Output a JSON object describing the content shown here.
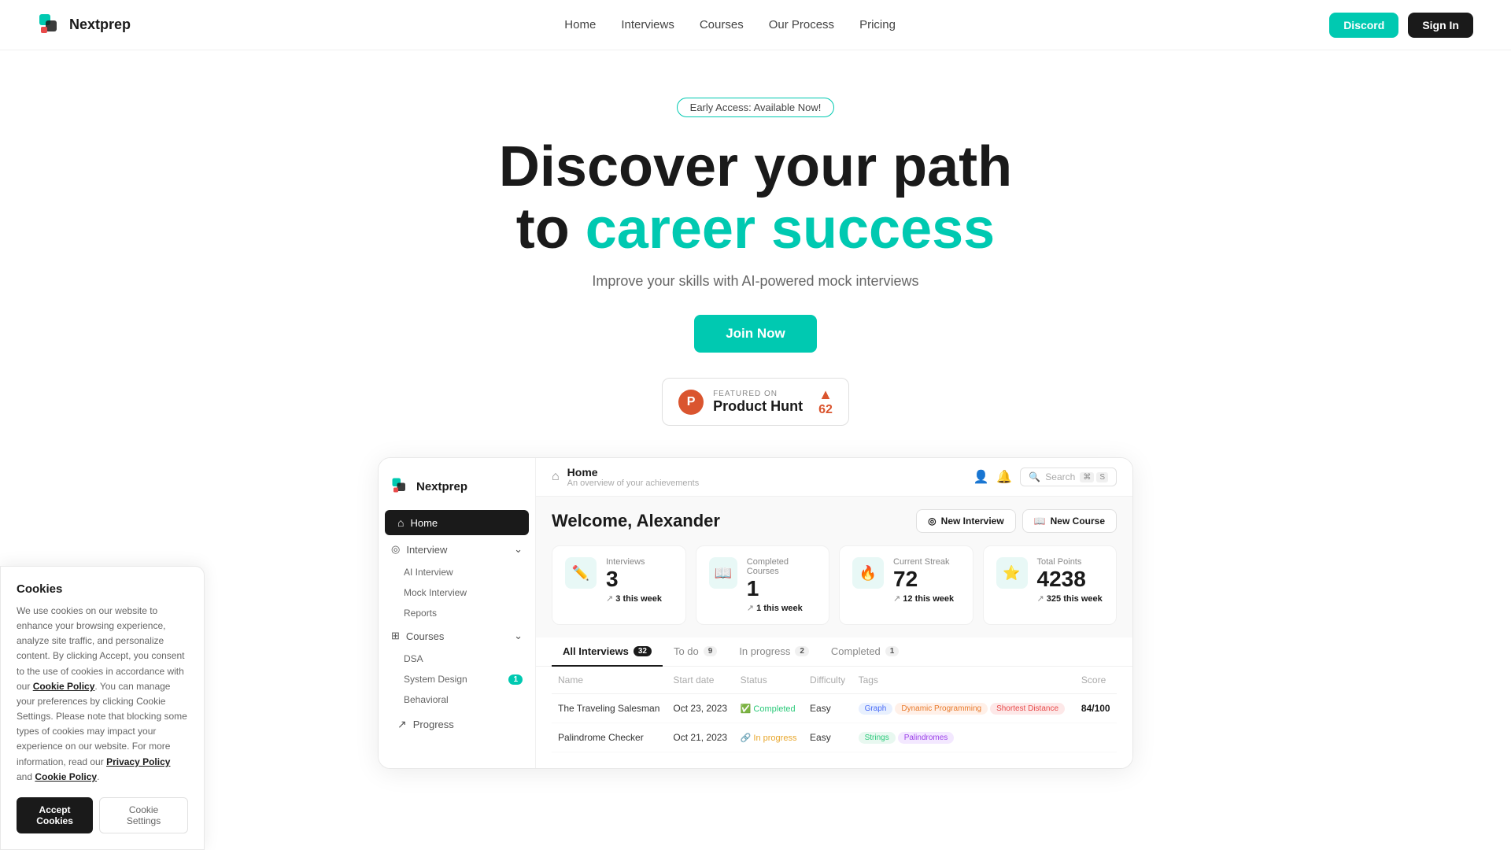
{
  "nav": {
    "logo_text": "Nextprep",
    "links": [
      "Home",
      "Interviews",
      "Courses",
      "Our Process",
      "Pricing"
    ],
    "discord_label": "Discord",
    "signin_label": "Sign In"
  },
  "hero": {
    "badge": "Early Access: Available Now!",
    "title_line1": "Discover your path",
    "title_line2_start": "to ",
    "title_line2_accent": "career success",
    "subtitle": "Improve your skills with AI-powered mock interviews",
    "cta_label": "Join Now",
    "product_hunt": {
      "featured_on": "FEATURED ON",
      "name": "Product Hunt",
      "votes": "62"
    }
  },
  "sidebar": {
    "logo_text": "Nextprep",
    "items": [
      {
        "label": "Home",
        "active": true
      },
      {
        "label": "Interview",
        "expandable": true
      },
      {
        "label": "AI Interview",
        "sub": true
      },
      {
        "label": "Mock Interview",
        "sub": true
      },
      {
        "label": "Reports",
        "sub": true
      },
      {
        "label": "Courses",
        "expandable": true
      },
      {
        "label": "DSA",
        "sub": true
      },
      {
        "label": "System Design",
        "sub": true,
        "badge": "1"
      },
      {
        "label": "Behavioral",
        "sub": true
      },
      {
        "label": "Progress"
      }
    ]
  },
  "topbar": {
    "home_label": "Home",
    "home_subtitle": "An overview of your achievements",
    "search_placeholder": "Search",
    "search_shortcut_1": "⌘",
    "search_shortcut_2": "S"
  },
  "welcome": {
    "greeting": "Welcome, Alexander",
    "btn_new_interview": "New Interview",
    "btn_new_course": "New Course"
  },
  "stats": [
    {
      "label": "Interviews",
      "value": "3",
      "sub_count": "3",
      "sub_text": "this week",
      "icon": "✏️"
    },
    {
      "label": "Completed Courses",
      "value": "1",
      "sub_count": "1",
      "sub_text": "this week",
      "icon": "📖"
    },
    {
      "label": "Current Streak",
      "value": "72",
      "sub_count": "12",
      "sub_text": "this week",
      "icon": "🔥"
    },
    {
      "label": "Total Points",
      "value": "4238",
      "sub_count": "325",
      "sub_text": "this week",
      "icon": "⭐"
    }
  ],
  "tabs": [
    {
      "label": "All Interviews",
      "count": "32",
      "active": true
    },
    {
      "label": "To do",
      "count": "9"
    },
    {
      "label": "In progress",
      "count": "2"
    },
    {
      "label": "Completed",
      "count": "1"
    }
  ],
  "table": {
    "headers": [
      "Name",
      "Start date",
      "Status",
      "Difficulty",
      "Tags",
      "Score"
    ],
    "rows": [
      {
        "name": "The Traveling Salesman",
        "date": "Oct 23, 2023",
        "status": "Completed",
        "status_type": "completed",
        "difficulty": "Easy",
        "tags": [
          "Graph",
          "Dynamic Programming",
          "Shortest Distance"
        ],
        "tag_classes": [
          "tag-graph",
          "tag-dp",
          "tag-shortest"
        ],
        "score": "84/100"
      },
      {
        "name": "Palindrome Checker",
        "date": "Oct 21, 2023",
        "status": "In progress",
        "status_type": "inprogress",
        "difficulty": "Easy",
        "tags": [
          "Strings",
          "Palindromes"
        ],
        "tag_classes": [
          "tag-strings",
          "tag-palindromes"
        ],
        "score": ""
      }
    ]
  },
  "cookie": {
    "title": "Cookies",
    "body": "We use cookies on our website to enhance your browsing experience, analyze site traffic, and personalize content. By clicking Accept, you consent to the use of cookies in accordance with our Cookie Policy. You can manage your preferences by clicking Cookie Settings. Please note that blocking some types of cookies may impact your experience on our website. For more information, read our Privacy Policy and Cookie Policy.",
    "accept_label": "Accept Cookies",
    "settings_label": "Cookie Settings"
  }
}
